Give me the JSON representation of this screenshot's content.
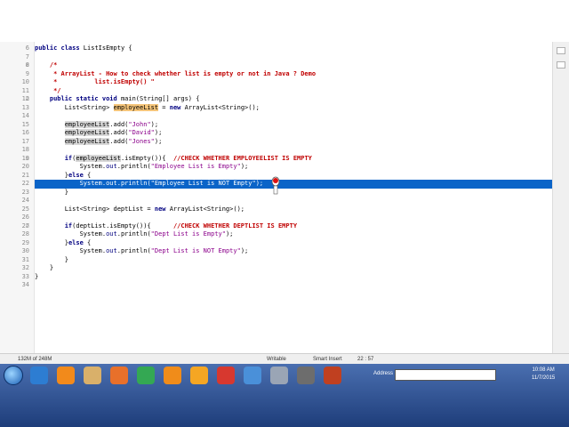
{
  "editor": {
    "lines": [
      {
        "n": "6",
        "parts": [
          [
            "kw",
            "public class "
          ],
          [
            "",
            "ListIsEmpty {"
          ]
        ]
      },
      {
        "n": "7",
        "parts": [
          [
            "",
            ""
          ]
        ]
      },
      {
        "n": "8",
        "fold": "⊟",
        "parts": [
          [
            "cm",
            "    /*"
          ]
        ]
      },
      {
        "n": "9",
        "parts": [
          [
            "cm",
            "     * ArrayList - How to check whether list is empty or not in Java ? Demo"
          ]
        ]
      },
      {
        "n": "10",
        "parts": [
          [
            "cm",
            "     *          list.isEmpty() \""
          ]
        ]
      },
      {
        "n": "11",
        "parts": [
          [
            "cm",
            "     */"
          ]
        ]
      },
      {
        "n": "12",
        "fold": "⊟",
        "parts": [
          [
            "kw",
            "    public static void "
          ],
          [
            "",
            "main(String[] args) {"
          ]
        ]
      },
      {
        "n": "13",
        "parts": [
          [
            "",
            "        List<String> "
          ],
          [
            "mark",
            "employeeList"
          ],
          [
            "",
            " = "
          ],
          [
            "kw",
            "new "
          ],
          [
            "",
            "ArrayList<String>();"
          ]
        ]
      },
      {
        "n": "14",
        "parts": [
          [
            "",
            ""
          ]
        ]
      },
      {
        "n": "15",
        "parts": [
          [
            "",
            "        "
          ],
          [
            "var",
            "employeeList"
          ],
          [
            "",
            ".add("
          ],
          [
            "str",
            "\"John\""
          ],
          [
            "",
            ");"
          ]
        ]
      },
      {
        "n": "16",
        "parts": [
          [
            "",
            "        "
          ],
          [
            "var",
            "employeeList"
          ],
          [
            "",
            ".add("
          ],
          [
            "str",
            "\"David\""
          ],
          [
            "",
            ");"
          ]
        ]
      },
      {
        "n": "17",
        "parts": [
          [
            "",
            "        "
          ],
          [
            "var",
            "employeeList"
          ],
          [
            "",
            ".add("
          ],
          [
            "str",
            "\"Jones\""
          ],
          [
            "",
            ");"
          ]
        ]
      },
      {
        "n": "18",
        "parts": [
          [
            "",
            ""
          ]
        ]
      },
      {
        "n": "19",
        "fold": "⊟",
        "parts": [
          [
            "kw",
            "        if"
          ],
          [
            "",
            "("
          ],
          [
            "var",
            "employeeList"
          ],
          [
            "",
            ".isEmpty()){  "
          ],
          [
            "cm",
            "//CHECK WHETHER EMPLOYEELIST IS EMPTY"
          ]
        ]
      },
      {
        "n": "20",
        "parts": [
          [
            "",
            "            System."
          ],
          [
            "fld",
            "out"
          ],
          [
            "",
            ".println("
          ],
          [
            "str",
            "\"Employee List is Empty\""
          ],
          [
            "",
            ");"
          ]
        ]
      },
      {
        "n": "21",
        "parts": [
          [
            "",
            "        }"
          ],
          [
            "kw",
            "else "
          ],
          [
            "",
            "{"
          ]
        ]
      },
      {
        "n": "22",
        "hl": true,
        "parts": [
          [
            "",
            "            System."
          ],
          [
            "fld",
            "out"
          ],
          [
            "",
            ".println("
          ],
          [
            "str",
            "\"Employee List is NOT Empty\""
          ],
          [
            "",
            ");"
          ]
        ]
      },
      {
        "n": "23",
        "parts": [
          [
            "",
            "        }"
          ]
        ]
      },
      {
        "n": "24",
        "parts": [
          [
            "",
            ""
          ]
        ]
      },
      {
        "n": "25",
        "parts": [
          [
            "",
            "        List<String> deptList = "
          ],
          [
            "kw",
            "new "
          ],
          [
            "",
            "ArrayList<String>();"
          ]
        ]
      },
      {
        "n": "26",
        "parts": [
          [
            "",
            ""
          ]
        ]
      },
      {
        "n": "27",
        "fold": "⊟",
        "parts": [
          [
            "kw",
            "        if"
          ],
          [
            "",
            "(deptList.isEmpty()){      "
          ],
          [
            "cm",
            "//CHECK WHETHER DEPTLIST IS EMPTY"
          ]
        ]
      },
      {
        "n": "28",
        "parts": [
          [
            "",
            "            System."
          ],
          [
            "fld",
            "out"
          ],
          [
            "",
            ".println("
          ],
          [
            "str",
            "\"Dept List is Empty\""
          ],
          [
            "",
            ");"
          ]
        ]
      },
      {
        "n": "29",
        "parts": [
          [
            "",
            "        }"
          ],
          [
            "kw",
            "else "
          ],
          [
            "",
            "{"
          ]
        ]
      },
      {
        "n": "30",
        "parts": [
          [
            "",
            "            System."
          ],
          [
            "fld",
            "out"
          ],
          [
            "",
            ".println("
          ],
          [
            "str",
            "\"Dept List is NOT Empty\""
          ],
          [
            "",
            ");"
          ]
        ]
      },
      {
        "n": "31",
        "parts": [
          [
            "",
            "        }"
          ]
        ]
      },
      {
        "n": "32",
        "parts": [
          [
            "",
            "    }"
          ]
        ]
      },
      {
        "n": "33",
        "parts": [
          [
            "",
            "}"
          ]
        ]
      },
      {
        "n": "34",
        "parts": [
          [
            "",
            ""
          ]
        ]
      }
    ]
  },
  "status": {
    "memory": "132M of 248M",
    "mode": "Writable",
    "insert": "Smart Insert",
    "position": "22 : 57"
  },
  "taskbar": {
    "address_label": "Address",
    "time": "10:08 AM",
    "date": "11/7/2015",
    "icon_colors": [
      "#2d7dd2",
      "#f28a1b",
      "#d9b06a",
      "#e8702a",
      "#34a853",
      "#f08c1a",
      "#f5a623",
      "#d7382f",
      "#4a90d9",
      "#9aa5b5",
      "#6d6d6d",
      "#c04020"
    ]
  }
}
